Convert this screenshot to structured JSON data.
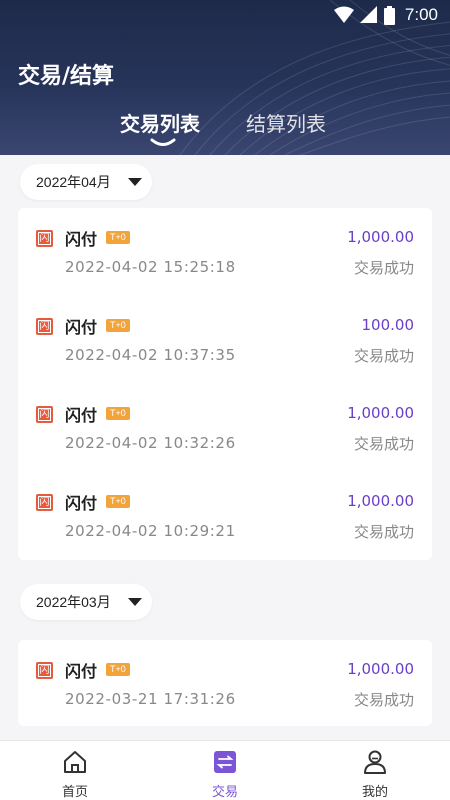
{
  "status_bar": {
    "time": "7:00"
  },
  "header": {
    "title": "交易/结算",
    "tabs": [
      {
        "label": "交易列表",
        "active": true
      },
      {
        "label": "结算列表",
        "active": false
      }
    ]
  },
  "groups": [
    {
      "month": "2022年04月",
      "transactions": [
        {
          "icon_char": "闪",
          "name": "闪付",
          "badge": "T+0",
          "amount": "1,000.00",
          "time": "2022-04-02 15:25:18",
          "status": "交易成功"
        },
        {
          "icon_char": "闪",
          "name": "闪付",
          "badge": "T+0",
          "amount": "100.00",
          "time": "2022-04-02 10:37:35",
          "status": "交易成功"
        },
        {
          "icon_char": "闪",
          "name": "闪付",
          "badge": "T+0",
          "amount": "1,000.00",
          "time": "2022-04-02 10:32:26",
          "status": "交易成功"
        },
        {
          "icon_char": "闪",
          "name": "闪付",
          "badge": "T+0",
          "amount": "1,000.00",
          "time": "2022-04-02 10:29:21",
          "status": "交易成功"
        }
      ]
    },
    {
      "month": "2022年03月",
      "transactions": [
        {
          "icon_char": "闪",
          "name": "闪付",
          "badge": "T+0",
          "amount": "1,000.00",
          "time": "2022-03-21 17:31:26",
          "status": "交易成功"
        }
      ]
    }
  ],
  "bottom_nav": [
    {
      "label": "首页",
      "icon": "home-icon",
      "active": false
    },
    {
      "label": "交易",
      "icon": "exchange-icon",
      "active": true
    },
    {
      "label": "我的",
      "icon": "user-icon",
      "active": false
    }
  ],
  "colors": {
    "header_bg": "#1e2a4a",
    "amount": "#6a3fc9",
    "accent": "#7b55d6",
    "badge": "#f2a33a",
    "pay_icon": "#e85a3c"
  }
}
